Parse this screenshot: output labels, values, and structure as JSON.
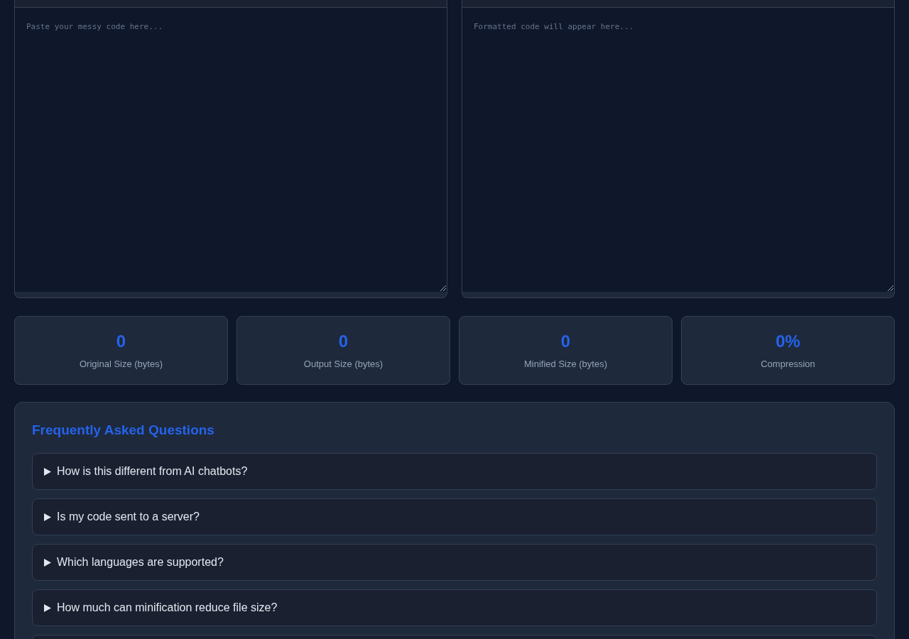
{
  "editors": [
    {
      "placeholder": "Paste your messy code here..."
    },
    {
      "placeholder": "Formatted code will appear here..."
    }
  ],
  "stats": [
    {
      "value": "0",
      "label": "Original Size (bytes)"
    },
    {
      "value": "0",
      "label": "Output Size (bytes)"
    },
    {
      "value": "0",
      "label": "Minified Size (bytes)"
    },
    {
      "value": "0%",
      "label": "Compression"
    }
  ],
  "faq": {
    "title": "Frequently Asked Questions",
    "items": [
      {
        "question": "How is this different from AI chatbots?",
        "expanded": false
      },
      {
        "question": "Is my code sent to a server?",
        "expanded": false
      },
      {
        "question": "Which languages are supported?",
        "expanded": false
      },
      {
        "question": "How much can minification reduce file size?",
        "expanded": false
      }
    ],
    "cut_off_item_below": true
  }
}
